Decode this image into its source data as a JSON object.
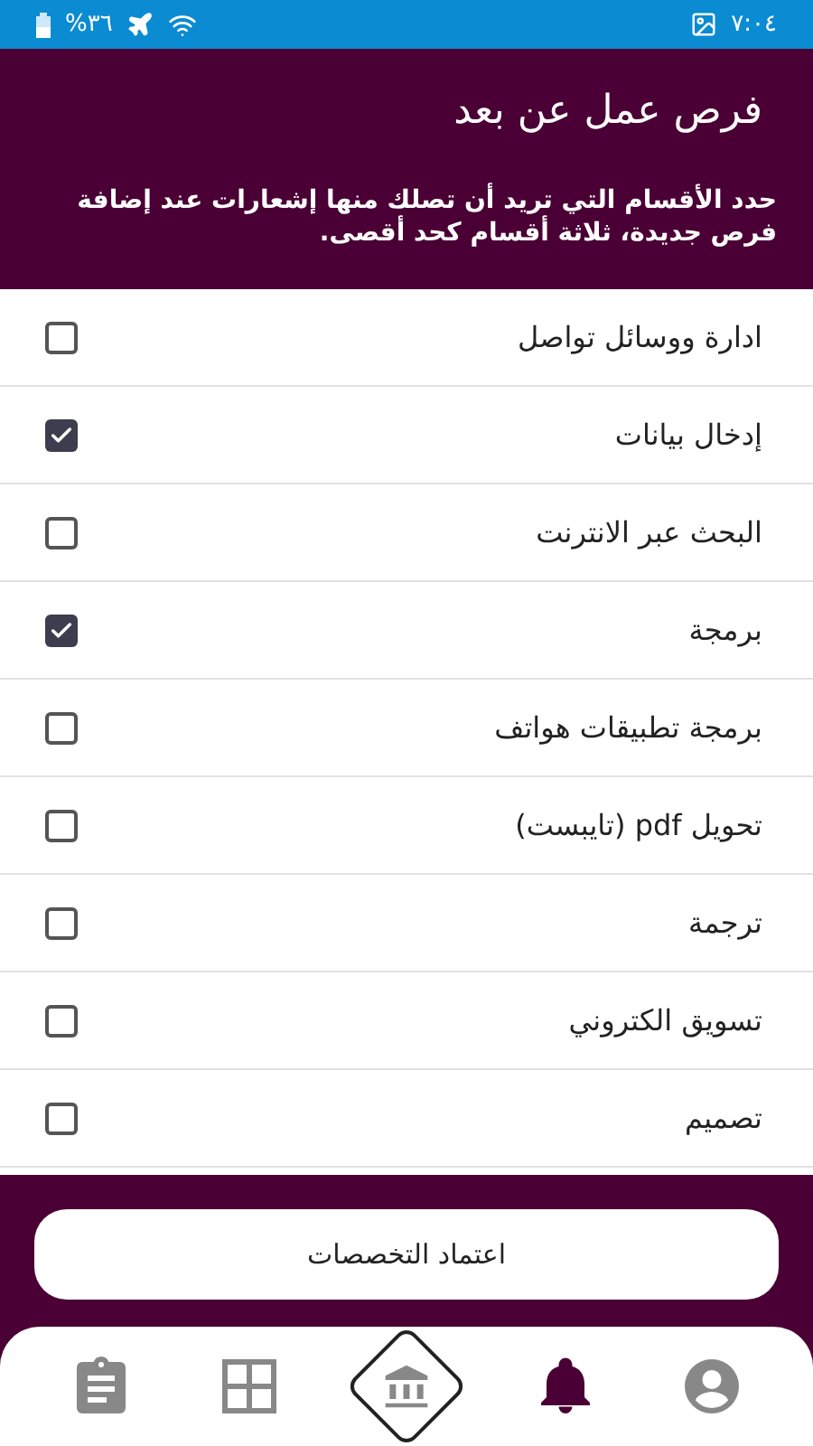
{
  "status_bar": {
    "time": "٧:٠٤",
    "battery": "%٣٦"
  },
  "header": {
    "title": "فرص عمل عن بعد",
    "description": "حدد الأقسام التي تريد أن تصلك منها إشعارات عند إضافة فرص جديدة، ثلاثة أقسام كحد أقصى."
  },
  "categories": [
    {
      "label": "ادارة ووسائل تواصل",
      "checked": false
    },
    {
      "label": "إدخال بيانات",
      "checked": true
    },
    {
      "label": "البحث عبر الانترنت",
      "checked": false
    },
    {
      "label": "برمجة",
      "checked": true
    },
    {
      "label": "برمجة تطبيقات هواتف",
      "checked": false
    },
    {
      "label": "تحويل pdf (تايبست)",
      "checked": false
    },
    {
      "label": "ترجمة",
      "checked": false
    },
    {
      "label": "تسويق الكتروني",
      "checked": false
    },
    {
      "label": "تصميم",
      "checked": false
    }
  ],
  "confirm_button": "اعتماد التخصصات",
  "bottom_nav": [
    {
      "kind": "profile",
      "selected": false
    },
    {
      "kind": "bell",
      "selected": true
    },
    {
      "kind": "grid",
      "selected": false
    },
    {
      "kind": "clipboard",
      "selected": false
    }
  ]
}
